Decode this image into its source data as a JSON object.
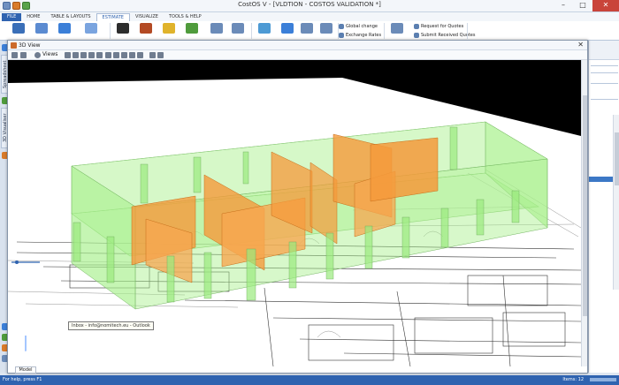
{
  "window": {
    "title": "CostOS V - [VLDTION - COSTOS VALIDATION *]"
  },
  "ribbon": {
    "tabs": [
      {
        "label": "FILE"
      },
      {
        "label": "HOME"
      },
      {
        "label": "TABLE & LAYOUTS"
      },
      {
        "label": "ESTIMATE"
      },
      {
        "label": "VISUALIZE"
      },
      {
        "label": "TOOLS & HELP"
      }
    ],
    "active_tab": "ESTIMATE",
    "commands": {
      "global_change": "Global change",
      "exchange_rates": "Exchange Rates",
      "request_quotes": "Request for Quotes",
      "submit_quotes": "Submit Received Quotes"
    }
  },
  "left_panel": {
    "tabs": [
      "Spreadsheet",
      "3D Visualiser"
    ]
  },
  "view_window": {
    "title": "3D View",
    "toolbar_views_label": "Views",
    "model_tab": "Model",
    "tooltip": "Inbox - info@nomitech.eu - Outlook"
  },
  "status": {
    "help": "For help, press F1",
    "right": "Items: 12"
  },
  "colors": {
    "accent": "#2f63b0",
    "wall_green": "#a6f08a",
    "wall_orange": "#f59a3b",
    "background": "#000000"
  }
}
